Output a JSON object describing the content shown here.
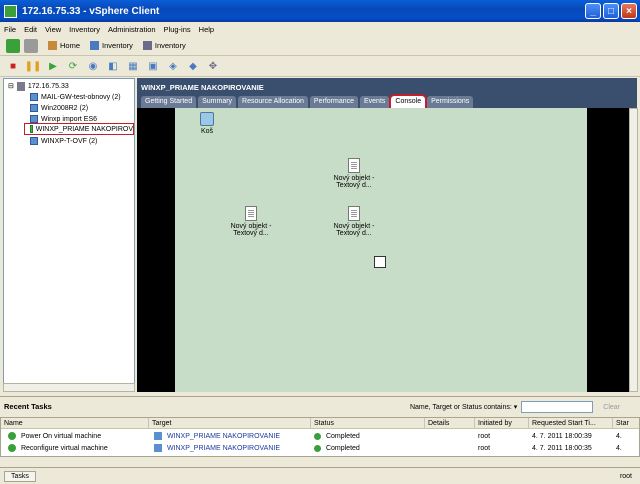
{
  "window": {
    "title": "172.16.75.33 - vSphere Client",
    "min": "_",
    "max": "□",
    "close": "×"
  },
  "menu": [
    "File",
    "Edit",
    "View",
    "Inventory",
    "Administration",
    "Plug-ins",
    "Help"
  ],
  "nav": {
    "home": "Home",
    "crumb1": "Inventory",
    "crumb2": "Inventory"
  },
  "tree": {
    "root": "172.16.75.33",
    "items": [
      "MAIL-GW-test-obnovy (2)",
      "Win2008R2 (2)",
      "Winxp import ES6",
      "WINXP_PRIAME NAKOPIROV",
      "WINXP-T-OVF (2)"
    ]
  },
  "vm": {
    "name": "WINXP_PRIAME NAKOPIROVANIE",
    "tabs": [
      "Getting Started",
      "Summary",
      "Resource Allocation",
      "Performance",
      "Events",
      "Console",
      "Permissions"
    ],
    "active_tab": "Console"
  },
  "desktop": {
    "bin": "Koš",
    "doc1_line1": "Nový objekt -",
    "doc1_line2": "Textový d...",
    "doc2_line1": "Nový objekt -",
    "doc2_line2": "Textový d...",
    "doc3_line1": "Nový objekt -",
    "doc3_line2": "Textový d..."
  },
  "tasks": {
    "title": "Recent Tasks",
    "filter_label": "Name, Target or Status contains: ▾",
    "clear": "Clear",
    "columns": [
      "Name",
      "Target",
      "Status",
      "Details",
      "Initiated by",
      "Requested Start Ti...",
      "Star"
    ],
    "rows": [
      {
        "name": "Power On virtual machine",
        "target": "WINXP_PRIAME NAKOPIROVANIE",
        "status": "Completed",
        "details": "",
        "by": "root",
        "time": "4. 7. 2011 18:00:39",
        "start": "4."
      },
      {
        "name": "Reconfigure virtual machine",
        "target": "WINXP_PRIAME NAKOPIROVANIE",
        "status": "Completed",
        "details": "",
        "by": "root",
        "time": "4. 7. 2011 18:00:35",
        "start": "4."
      }
    ]
  },
  "status": {
    "tasks_button": "Tasks",
    "user": "root"
  }
}
